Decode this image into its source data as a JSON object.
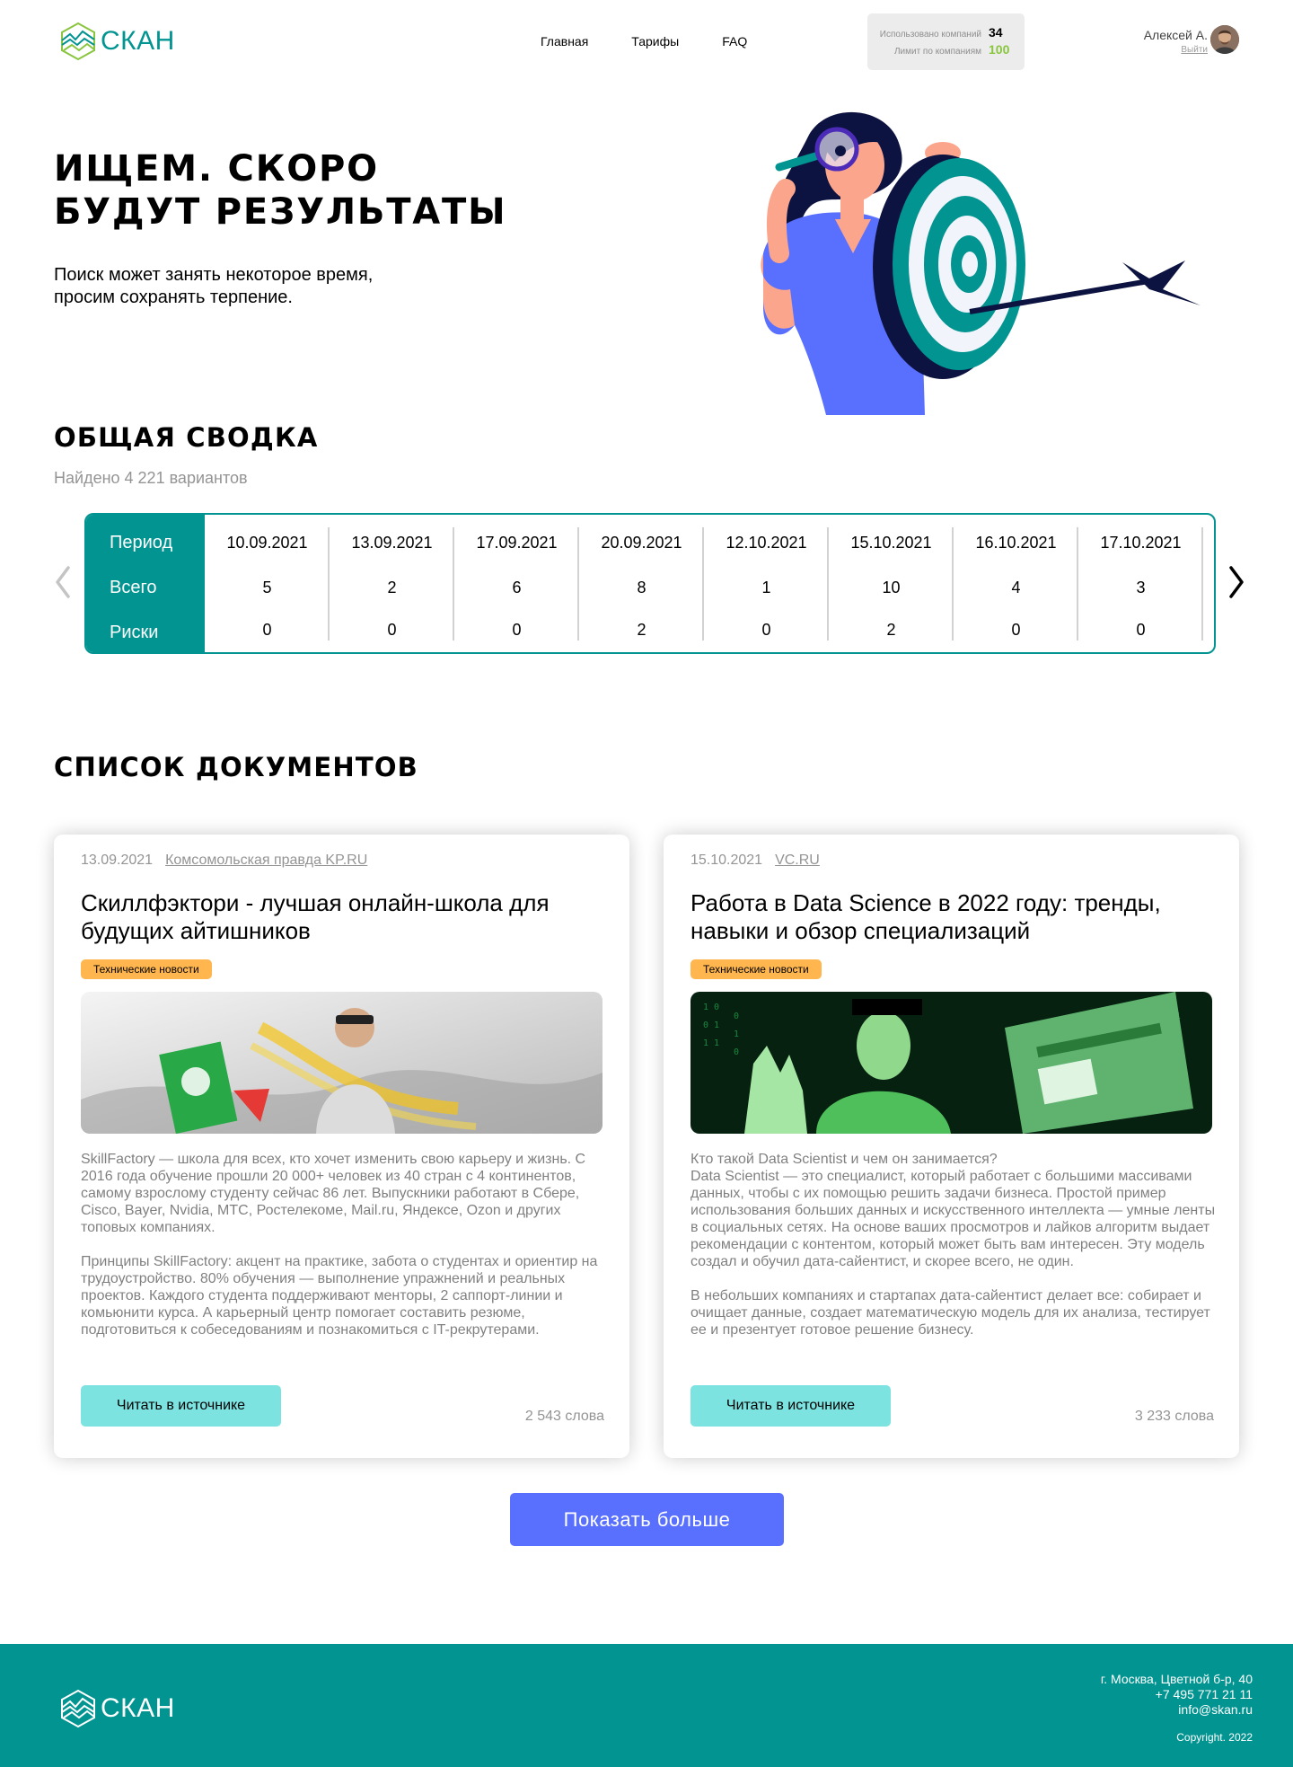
{
  "header": {
    "logo_text": "СКАН",
    "nav": [
      "Главная",
      "Тарифы",
      "FAQ"
    ],
    "limits": {
      "used_label": "Использовано компаний",
      "used_value": "34",
      "limit_label": "Лимит по компаниям",
      "limit_value": "100"
    },
    "user": {
      "name": "Алексей А.",
      "logout": "Выйти"
    }
  },
  "hero": {
    "title_line1": "Ищем. Скоро",
    "title_line2": "будут результаты",
    "subtitle_line1": "Поиск может занять некоторое время,",
    "subtitle_line2": "просим сохранять терпение."
  },
  "summary": {
    "title": "Общая сводка",
    "found": "Найдено 4 221 вариантов",
    "row_labels": [
      "Период",
      "Всего",
      "Риски"
    ],
    "columns": [
      {
        "date": "10.09.2021",
        "total": "5",
        "risks": "0"
      },
      {
        "date": "13.09.2021",
        "total": "2",
        "risks": "0"
      },
      {
        "date": "17.09.2021",
        "total": "6",
        "risks": "0"
      },
      {
        "date": "20.09.2021",
        "total": "8",
        "risks": "2"
      },
      {
        "date": "12.10.2021",
        "total": "1",
        "risks": "0"
      },
      {
        "date": "15.10.2021",
        "total": "10",
        "risks": "2"
      },
      {
        "date": "16.10.2021",
        "total": "4",
        "risks": "0"
      },
      {
        "date": "17.10.2021",
        "total": "3",
        "risks": "0"
      }
    ]
  },
  "documents": {
    "title": "Список документов",
    "items": [
      {
        "date": "13.09.2021",
        "source": "Комсомольская правда KP.RU",
        "title": "Скиллфэктори - лучшая онлайн-школа для будущих айтишников",
        "tag": "Технические новости",
        "text": "SkillFactory — школа для всех, кто хочет изменить свою карьеру и жизнь. С 2016 года обучение прошли 20 000+ человек из 40 стран с 4 континентов, самому взрослому студенту сейчас 86 лет. Выпускники работают в Сбере, Cisco, Bayer, Nvidia, МТС, Ростелекоме, Mail.ru, Яндексе, Ozon и других топовых компаниях.\n\nПринципы SkillFactory: акцент на практике, забота о студентах и ориентир на трудоустройство. 80% обучения — выполнение упражнений и реальных проектов. Каждого студента поддерживают менторы, 2 саппорт-линии и комьюнити курса. А карьерный центр помогает составить резюме, подготовиться к собеседованиям и познакомиться с IT-рекрутерами.",
        "button": "Читать в источнике",
        "words": "2 543 слова"
      },
      {
        "date": "15.10.2021",
        "source": "VC.RU",
        "title": "Работа в Data Science в 2022 году: тренды, навыки и обзор специализаций",
        "tag": "Технические новости",
        "text": "Кто такой Data Scientist и чем он занимается?\nData Scientist — это специалист, который работает с большими массивами данных, чтобы с их помощью решить задачи бизнеса. Простой пример использования больших данных и искусственного интеллекта — умные ленты в социальных сетях. На основе ваших просмотров и лайков алгоритм выдает рекомендации с контентом, который может быть вам интересен. Эту модель создал и обучил дата-сайентист, и скорее всего, не один.\n\nВ небольших компаниях и стартапах дата-сайентист делает все: собирает и очищает данные, создает математическую модель для их анализа, тестирует ее и презентует готовое решение бизнесу.",
        "button": "Читать в источнике",
        "words": "3 233 слова"
      }
    ],
    "more_button": "Показать больше"
  },
  "footer": {
    "logo_text": "СКАН",
    "address": "г. Москва, Цветной б-р, 40",
    "phone": "+7 495 771 21 11",
    "email": "info@skan.ru",
    "copyright": "Copyright. 2022"
  },
  "colors": {
    "brand": "#029491",
    "accent_button": "#5970ff",
    "read_button": "#7ce3e1",
    "tag": "#ffb64f",
    "limit_value": "#8ac540"
  },
  "icons": [
    "logo-icon",
    "avatar",
    "chevron-left-icon",
    "chevron-right-icon"
  ]
}
